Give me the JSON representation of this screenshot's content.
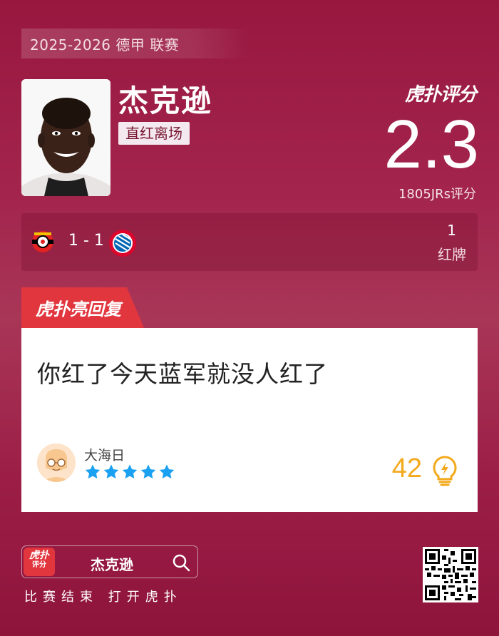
{
  "season": "2025-2026 德甲 联赛",
  "player": {
    "name": "杰克逊",
    "tag": "直红离场"
  },
  "rating": {
    "brand": "虎扑评分",
    "score": "2.3",
    "count_label": "1805JRs评分"
  },
  "match": {
    "home_icon": "leverkusen-crest-icon",
    "away_icon": "bayern-crest-icon",
    "score": "1 - 1",
    "stat_value": "1",
    "stat_label": "红牌"
  },
  "highlight": {
    "tab_label": "虎扑亮回复",
    "reply_text": "你红了今天蓝军就没人红了",
    "user": "大海日",
    "stars": 5,
    "likes": "42"
  },
  "footer": {
    "app_icon_text_top": "虎扑",
    "app_icon_text_bottom": "评分",
    "search_text": "杰克逊",
    "cta": "比赛结束 打开虎扑"
  },
  "colors": {
    "accent_red": "#e2363f",
    "likes_orange": "#f3a91c",
    "star_blue": "#1ba1f2"
  }
}
